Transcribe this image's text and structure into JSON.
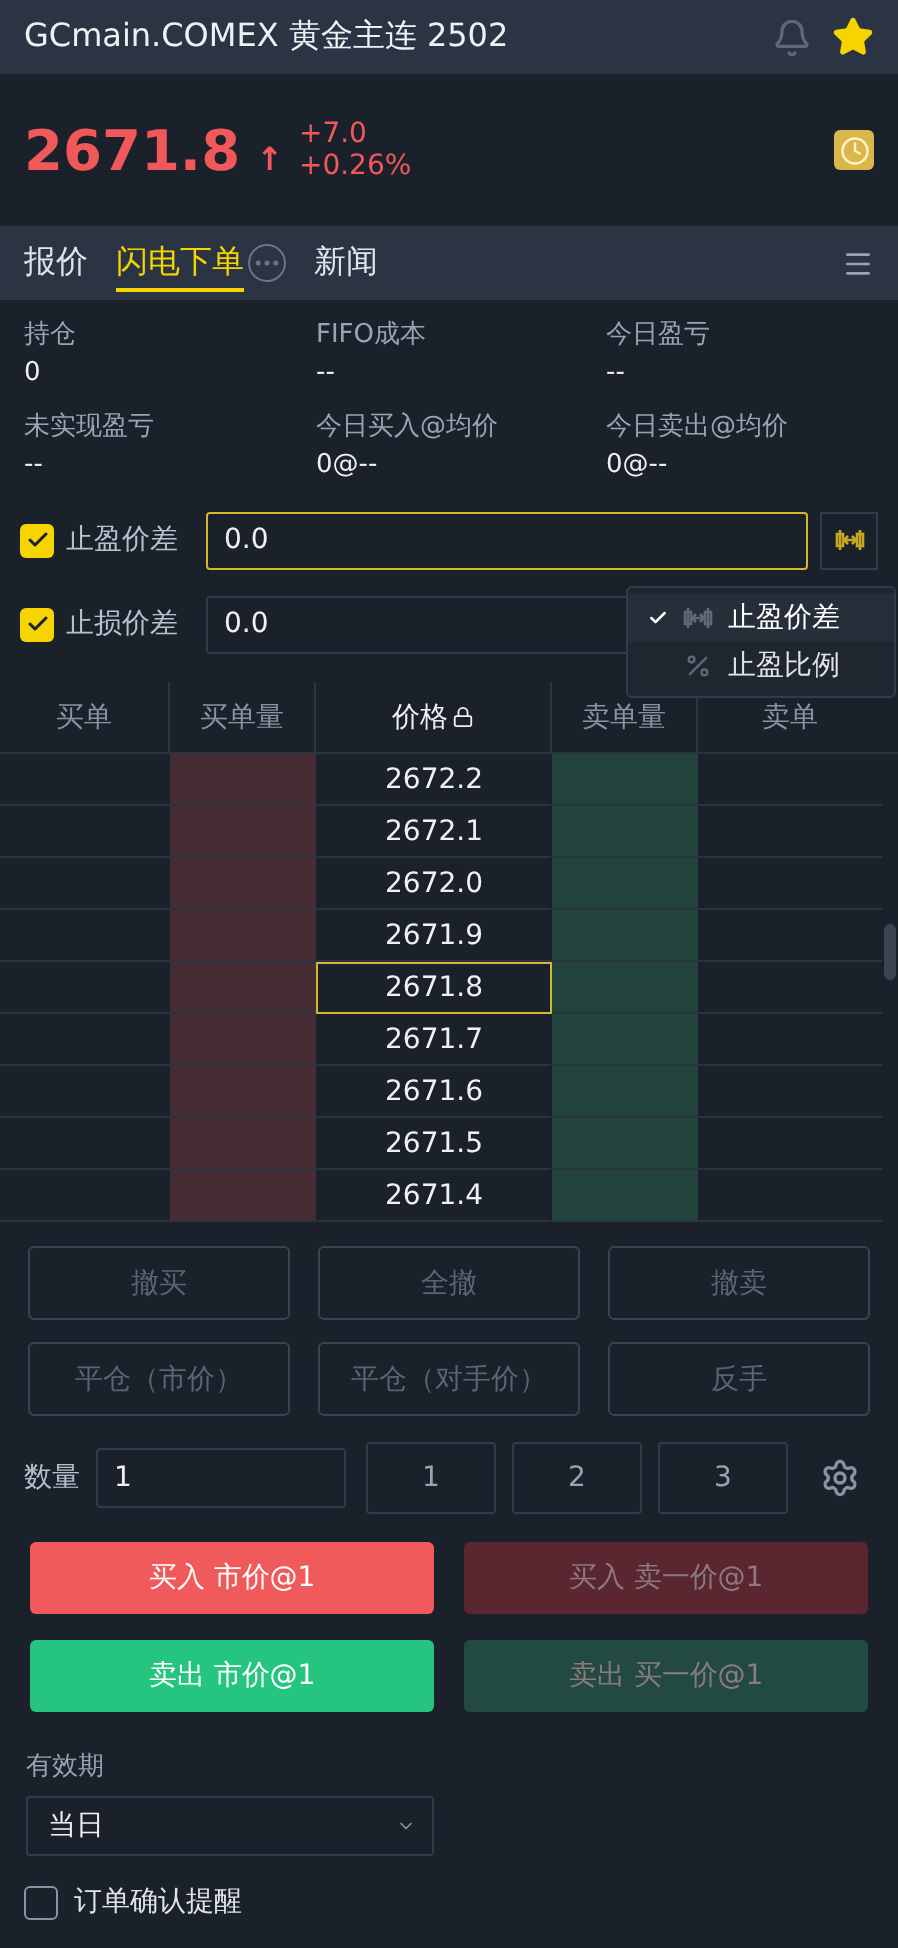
{
  "header": {
    "title": "GCmain.COMEX 黄金主连 2502",
    "favorite": true
  },
  "quote": {
    "price": "2671.8",
    "arrow": "↑",
    "change": "+7.0",
    "change_pct": "+0.26%"
  },
  "tabs": [
    {
      "label": "报价",
      "selected": false
    },
    {
      "label": "闪电下单",
      "selected": true
    },
    {
      "label": "新闻",
      "selected": false
    }
  ],
  "stats": [
    {
      "label": "持仓",
      "value": "0"
    },
    {
      "label": "FIFO成本",
      "value": "--"
    },
    {
      "label": "今日盈亏",
      "value": "--"
    },
    {
      "label": "未实现盈亏",
      "value": "--"
    },
    {
      "label": "今日买入@均价",
      "value": "0@--"
    },
    {
      "label": "今日卖出@均价",
      "value": "0@--"
    }
  ],
  "stop_rows": [
    {
      "label": "止盈价差",
      "checked": true,
      "value": "0.0",
      "focused": true
    },
    {
      "label": "止损价差",
      "checked": true,
      "value": "0.0",
      "focused": false
    }
  ],
  "mode_menu": [
    {
      "label": "止盈价差",
      "kind": "spread",
      "selected": true
    },
    {
      "label": "止盈比例",
      "kind": "percent",
      "selected": false
    }
  ],
  "ladder": {
    "columns": [
      "买单",
      "买单量",
      "价格",
      "卖单量",
      "卖单"
    ],
    "rows": [
      {
        "price": "2672.2",
        "selected": false
      },
      {
        "price": "2672.1",
        "selected": false
      },
      {
        "price": "2672.0",
        "selected": false
      },
      {
        "price": "2671.9",
        "selected": false
      },
      {
        "price": "2671.8",
        "selected": true
      },
      {
        "price": "2671.7",
        "selected": false
      },
      {
        "price": "2671.6",
        "selected": false
      },
      {
        "price": "2671.5",
        "selected": false
      },
      {
        "price": "2671.4",
        "selected": false
      }
    ]
  },
  "action_buttons": [
    "撤买",
    "全撤",
    "撤卖",
    "平仓（市价）",
    "平仓（对手价）",
    "反手"
  ],
  "quantity": {
    "label": "数量",
    "value": "1",
    "presets": [
      "1",
      "2",
      "3"
    ]
  },
  "order_buttons": [
    {
      "label": "买入 市价@1",
      "kind": "buy",
      "disabled": false
    },
    {
      "label": "买入 卖一价@1",
      "kind": "buy",
      "disabled": true
    },
    {
      "label": "卖出 市价@1",
      "kind": "sell",
      "disabled": false
    },
    {
      "label": "卖出 买一价@1",
      "kind": "sell",
      "disabled": true
    }
  ],
  "validity": {
    "label": "有效期",
    "value": "当日"
  },
  "confirm": {
    "label": "订单确认提醒",
    "checked": false
  }
}
